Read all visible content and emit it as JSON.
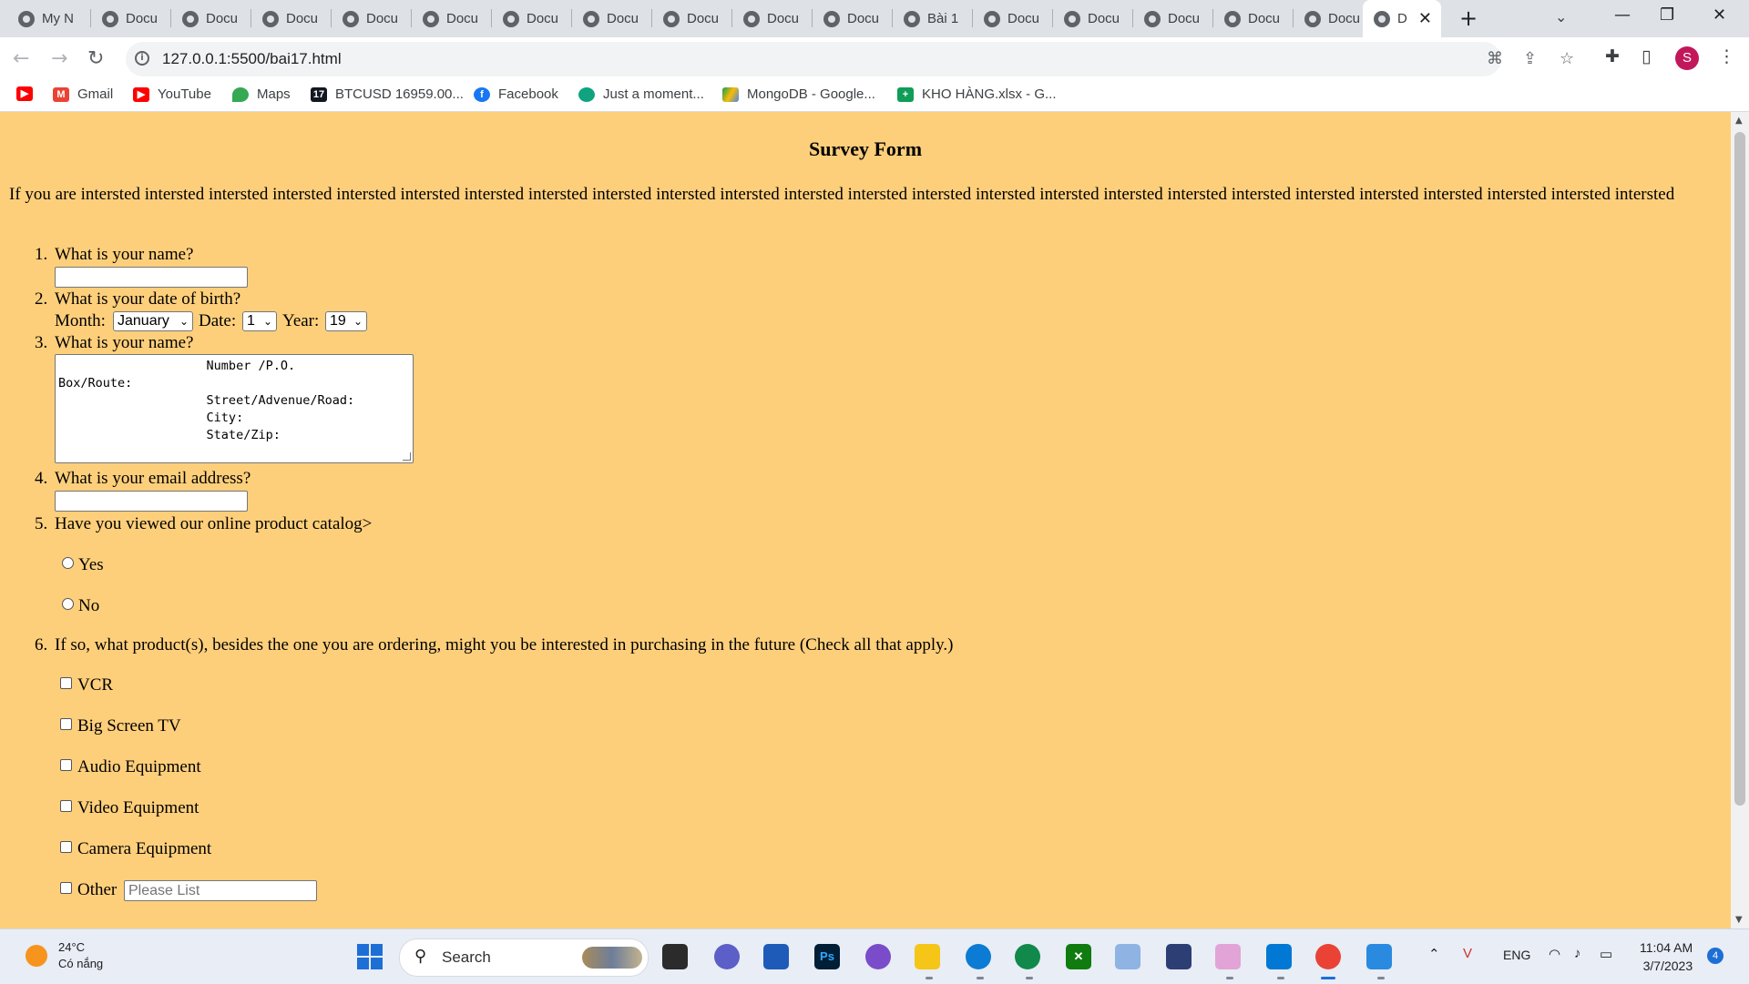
{
  "tabs": [
    {
      "title": "My N"
    },
    {
      "title": "Docu"
    },
    {
      "title": "Docu"
    },
    {
      "title": "Docu"
    },
    {
      "title": "Docu"
    },
    {
      "title": "Docu"
    },
    {
      "title": "Docu"
    },
    {
      "title": "Docu"
    },
    {
      "title": "Docu"
    },
    {
      "title": "Docu"
    },
    {
      "title": "Docu"
    },
    {
      "title": "Bài 1"
    },
    {
      "title": "Docu"
    },
    {
      "title": "Docu"
    },
    {
      "title": "Docu"
    },
    {
      "title": "Docu"
    },
    {
      "title": "Docu"
    },
    {
      "title": "D",
      "active": true
    }
  ],
  "window": {
    "new_tab": "+",
    "tab_search": "⌄",
    "minimize": "—",
    "restore": "❐",
    "close": "✕"
  },
  "toolbar": {
    "url": "127.0.0.1:5500/bai17.html",
    "back": "←",
    "forward": "→",
    "reload": "↻",
    "profile_initial": "S"
  },
  "bookmarks": [
    {
      "label": "",
      "icon": "youtube-icon",
      "color": "#ff0000"
    },
    {
      "label": "Gmail",
      "icon": "gmail-icon",
      "color": "#ea4335"
    },
    {
      "label": "YouTube",
      "icon": "youtube-icon",
      "color": "#ff0000"
    },
    {
      "label": "Maps",
      "icon": "maps-icon",
      "color": "#34a853"
    },
    {
      "label": "BTCUSD 16959.00...",
      "icon": "tradingview-icon",
      "color": "#131722"
    },
    {
      "label": "Facebook",
      "icon": "facebook-icon",
      "color": "#1877f2"
    },
    {
      "label": "Just a moment...",
      "icon": "openai-icon",
      "color": "#10a37f"
    },
    {
      "label": "MongoDB - Google...",
      "icon": "drive-icon",
      "color": "#fbbc04"
    },
    {
      "label": "KHO HÀNG.xlsx - G...",
      "icon": "sheets-icon",
      "color": "#0f9d58"
    }
  ],
  "page": {
    "background": "#fecf7b",
    "title": "Survey Form",
    "intro": "If you are intersted intersted intersted intersted intersted intersted intersted intersted intersted intersted intersted intersted intersted intersted intersted intersted intersted intersted intersted intersted intersted intersted intersted intersted intersted",
    "q1": "What is your name?",
    "q2": "What is your date of birth?",
    "month_label": "Month:",
    "month_value": "January",
    "date_label": "Date:",
    "date_value": "1",
    "year_label": "Year:",
    "year_value": "19",
    "q3": "What is your name?",
    "address_text": "                    Number /P.O.\nBox/Route:\n                    Street/Advenue/Road:\n                    City:\n                    State/Zip:",
    "q4": "What is your email address?",
    "q5": "Have you viewed our online product catalog>",
    "q5_options": [
      "Yes",
      "No"
    ],
    "q6": "If so, what product(s), besides the one you are ordering, might you be interested in purchasing in the future (Check all that apply.)",
    "q6_options": [
      "VCR",
      "Big Screen TV",
      "Audio Equipment",
      "Video Equipment",
      "Camera Equipment",
      "Other"
    ],
    "other_placeholder": "Please List"
  },
  "taskbar": {
    "temperature": "24°C",
    "weather": "Có nắng",
    "search": "Search",
    "language": "ENG",
    "time": "11:04 AM",
    "date": "3/7/2023",
    "notifications": "4"
  }
}
